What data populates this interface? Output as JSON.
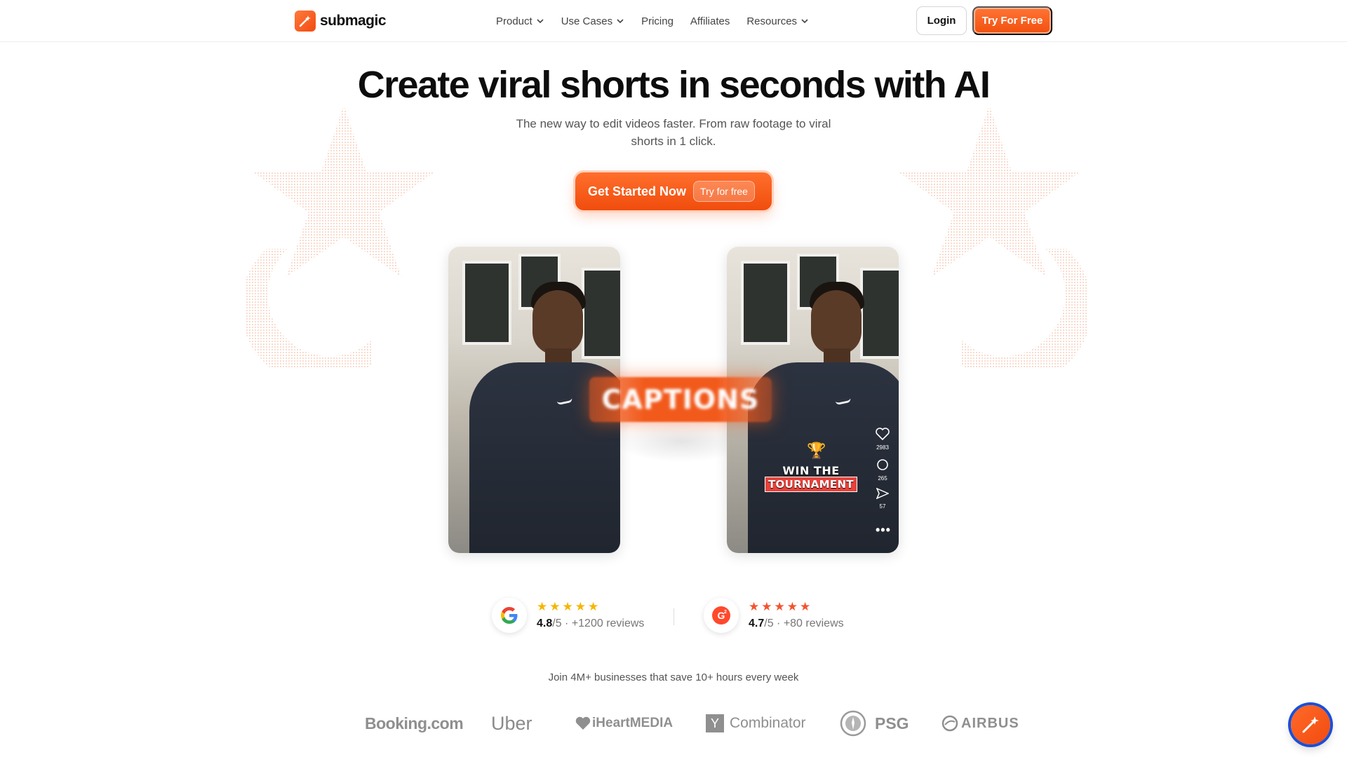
{
  "nav": {
    "brand": "submagic",
    "links": [
      "Product",
      "Use Cases",
      "Pricing",
      "Affiliates",
      "Resources"
    ],
    "login_label": "Login",
    "try_label": "Try For Free"
  },
  "hero": {
    "title": "Create viral shorts in seconds with AI",
    "subtitle": "The new way to edit videos faster. From raw footage to viral shorts in 1 click.",
    "cta_label": "Get Started Now",
    "cta_pill": "Try for free"
  },
  "videos": {
    "transition_caption": "CAPTIONS",
    "caption_line1": "WIN THE",
    "caption_line2": "TOURNAMENT",
    "like_count": "2983",
    "comment_count": "265",
    "share_count": "57"
  },
  "reviews": [
    {
      "source_icon": "google-icon",
      "stars": 5,
      "score": "4.8",
      "out_of": "/5",
      "count": "+1200 reviews",
      "star_color": "#f7b500"
    },
    {
      "source_icon": "g2-icon",
      "stars": 5,
      "score": "4.7",
      "out_of": "/5",
      "count": "+80 reviews",
      "star_color": "#f3532f"
    }
  ],
  "social_proof": "Join 4M+ businesses that save 10+ hours every week",
  "logos": [
    "Booking.com",
    "Uber",
    "iHeartMEDIA",
    "Combinator",
    "PSG",
    "AIRBUS"
  ],
  "colors": {
    "accent": "#f25a1c",
    "text": "#111111"
  }
}
